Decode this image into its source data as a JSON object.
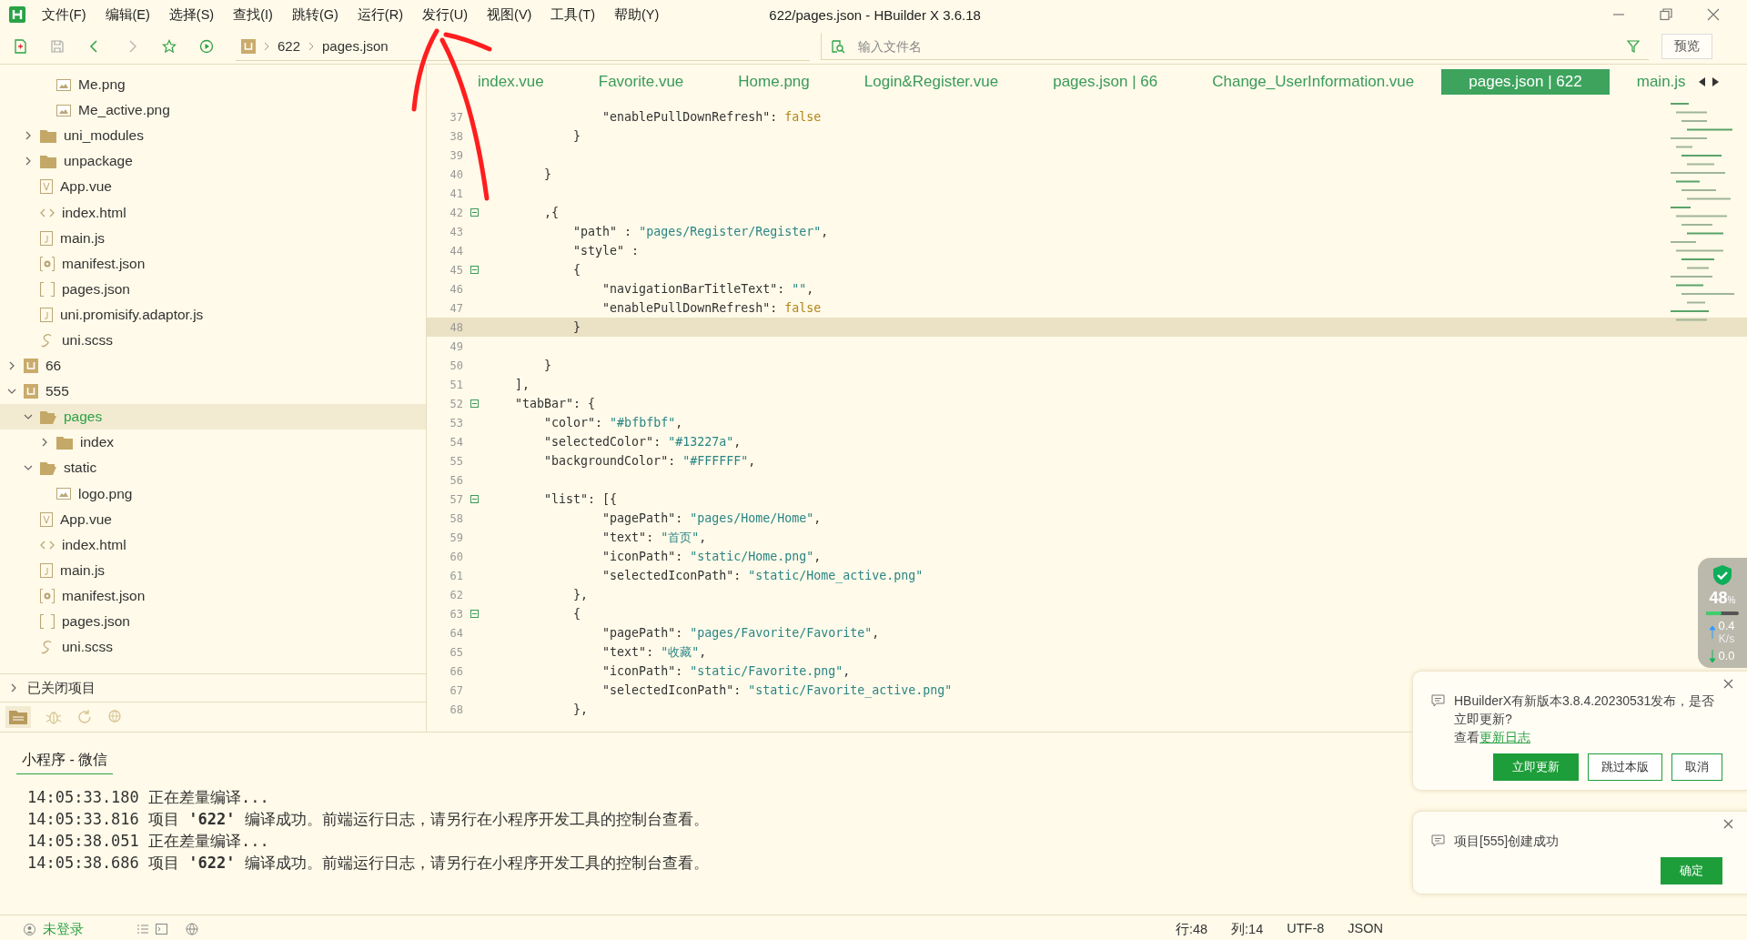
{
  "window": {
    "title": "622/pages.json - HBuilder X 3.6.18"
  },
  "menu": [
    "文件(F)",
    "编辑(E)",
    "选择(S)",
    "查找(I)",
    "跳转(G)",
    "运行(R)",
    "发行(U)",
    "视图(V)",
    "工具(T)",
    "帮助(Y)"
  ],
  "toolbar": {
    "breadcrumb": [
      "622",
      "pages.json"
    ],
    "search": {
      "placeholder": "输入文件名"
    },
    "preview_button": "预览"
  },
  "sidebar": {
    "tree": [
      {
        "children": [
          {
            "children": [
              {
                "label": "Me.png",
                "kind": "image",
                "selected": false
              },
              {
                "label": "Me_active.png",
                "kind": "image",
                "selected": false
              }
            ]
          },
          {
            "label": "uni_modules",
            "kind": "folder",
            "expanded": false,
            "selected": false
          },
          {
            "label": "unpackage",
            "kind": "folder",
            "expanded": false,
            "selected": false
          },
          {
            "label": "App.vue",
            "kind": "vue",
            "selected": false
          },
          {
            "label": "index.html",
            "kind": "html",
            "selected": false
          },
          {
            "label": "main.js",
            "kind": "js",
            "selected": false
          },
          {
            "label": "manifest.json",
            "kind": "config",
            "selected": false
          },
          {
            "label": "pages.json",
            "kind": "json",
            "selected": false
          },
          {
            "label": "uni.promisify.adaptor.js",
            "kind": "js",
            "selected": false
          },
          {
            "label": "uni.scss",
            "kind": "scss",
            "selected": false
          }
        ]
      },
      {
        "label": "66",
        "kind": "project",
        "expanded": false,
        "selected": false
      },
      {
        "label": "555",
        "kind": "project",
        "expanded": true,
        "selected": false,
        "children": [
          {
            "label": "pages",
            "kind": "folder",
            "expanded": true,
            "selected": true,
            "children": [
              {
                "label": "index",
                "kind": "folder",
                "expanded": false,
                "selected": false
              }
            ]
          },
          {
            "label": "static",
            "kind": "folder",
            "expanded": true,
            "selected": false,
            "children": [
              {
                "label": "logo.png",
                "kind": "image",
                "selected": false
              }
            ]
          },
          {
            "label": "App.vue",
            "kind": "vue",
            "selected": false
          },
          {
            "label": "index.html",
            "kind": "html",
            "selected": false
          },
          {
            "label": "main.js",
            "kind": "js",
            "selected": false
          },
          {
            "label": "manifest.json",
            "kind": "config",
            "selected": false
          },
          {
            "label": "pages.json",
            "kind": "json",
            "selected": false
          },
          {
            "label": "uni.scss",
            "kind": "scss",
            "selected": false
          }
        ]
      }
    ],
    "closed_projects": {
      "label": "已关闭项目",
      "expanded": false
    }
  },
  "tabs": [
    {
      "label": "index.vue",
      "selected": false
    },
    {
      "label": "Favorite.vue",
      "selected": false
    },
    {
      "label": "Home.png",
      "selected": false
    },
    {
      "label": "Login&Register.vue",
      "selected": false
    },
    {
      "label": "pages.json | 66",
      "selected": false
    },
    {
      "label": "Change_UserInformation.vue",
      "selected": false
    },
    {
      "label": "pages.json | 622",
      "selected": true
    },
    {
      "label": "main.js",
      "selected": false
    }
  ],
  "code": [
    {
      "n": "37",
      "tokens": [
        {
          "kind": "key",
          "s": "                \"enablePullDownRefresh\""
        },
        {
          "kind": "p",
          "s": ": "
        },
        {
          "kind": "kw",
          "s": "false"
        }
      ]
    },
    {
      "n": "38",
      "tokens": [
        {
          "kind": "p",
          "s": "            }"
        }
      ]
    },
    {
      "n": "39"
    },
    {
      "n": "40",
      "tokens": [
        {
          "kind": "p",
          "s": "        }"
        }
      ]
    },
    {
      "n": "41"
    },
    {
      "n": "42",
      "fold": true,
      "tokens": [
        {
          "kind": "p",
          "s": "        ,{"
        }
      ]
    },
    {
      "n": "43",
      "tokens": [
        {
          "kind": "key",
          "s": "            \"path\""
        },
        {
          "kind": "p",
          "s": " : "
        },
        {
          "kind": "str",
          "s": "\"pages/Register/Register\""
        },
        {
          "kind": "p",
          "s": ","
        }
      ]
    },
    {
      "n": "44",
      "tokens": [
        {
          "kind": "key",
          "s": "            \"style\""
        },
        {
          "kind": "p",
          "s": " :"
        }
      ]
    },
    {
      "n": "45",
      "fold": true,
      "tokens": [
        {
          "kind": "p",
          "s": "            {"
        }
      ]
    },
    {
      "n": "46",
      "tokens": [
        {
          "kind": "key",
          "s": "                \"navigationBarTitleText\""
        },
        {
          "kind": "p",
          "s": ": "
        },
        {
          "kind": "str",
          "s": "\"\""
        },
        {
          "kind": "p",
          "s": ","
        }
      ]
    },
    {
      "n": "47",
      "tokens": [
        {
          "kind": "key",
          "s": "                \"enablePullDownRefresh\""
        },
        {
          "kind": "p",
          "s": ": "
        },
        {
          "kind": "kw",
          "s": "false"
        }
      ]
    },
    {
      "n": "48",
      "current": true,
      "tokens": [
        {
          "kind": "p",
          "s": "            }"
        }
      ]
    },
    {
      "n": "49"
    },
    {
      "n": "50",
      "tokens": [
        {
          "kind": "p",
          "s": "        }"
        }
      ]
    },
    {
      "n": "51",
      "tokens": [
        {
          "kind": "p",
          "s": "    ],"
        }
      ]
    },
    {
      "n": "52",
      "fold": true,
      "tokens": [
        {
          "kind": "key",
          "s": "    \"tabBar\""
        },
        {
          "kind": "p",
          "s": ": {"
        }
      ]
    },
    {
      "n": "53",
      "tokens": [
        {
          "kind": "key",
          "s": "        \"color\""
        },
        {
          "kind": "p",
          "s": ": "
        },
        {
          "kind": "str",
          "s": "\"#bfbfbf\""
        },
        {
          "kind": "p",
          "s": ","
        }
      ]
    },
    {
      "n": "54",
      "tokens": [
        {
          "kind": "key",
          "s": "        \"selectedColor\""
        },
        {
          "kind": "p",
          "s": ": "
        },
        {
          "kind": "str",
          "s": "\"#13227a\""
        },
        {
          "kind": "p",
          "s": ","
        }
      ]
    },
    {
      "n": "55",
      "tokens": [
        {
          "kind": "key",
          "s": "        \"backgroundColor\""
        },
        {
          "kind": "p",
          "s": ": "
        },
        {
          "kind": "str",
          "s": "\"#FFFFFF\""
        },
        {
          "kind": "p",
          "s": ","
        }
      ]
    },
    {
      "n": "56"
    },
    {
      "n": "57",
      "fold": true,
      "tokens": [
        {
          "kind": "key",
          "s": "        \"list\""
        },
        {
          "kind": "p",
          "s": ": [{"
        }
      ]
    },
    {
      "n": "58",
      "tokens": [
        {
          "kind": "key",
          "s": "                \"pagePath\""
        },
        {
          "kind": "p",
          "s": ": "
        },
        {
          "kind": "str",
          "s": "\"pages/Home/Home\""
        },
        {
          "kind": "p",
          "s": ","
        }
      ]
    },
    {
      "n": "59",
      "tokens": [
        {
          "kind": "key",
          "s": "                \"text\""
        },
        {
          "kind": "p",
          "s": ": "
        },
        {
          "kind": "str",
          "s": "\"首页\""
        },
        {
          "kind": "p",
          "s": ","
        }
      ]
    },
    {
      "n": "60",
      "tokens": [
        {
          "kind": "key",
          "s": "                \"iconPath\""
        },
        {
          "kind": "p",
          "s": ": "
        },
        {
          "kind": "str",
          "s": "\"static/Home.png\""
        },
        {
          "kind": "p",
          "s": ","
        }
      ]
    },
    {
      "n": "61",
      "tokens": [
        {
          "kind": "key",
          "s": "                \"selectedIconPath\""
        },
        {
          "kind": "p",
          "s": ": "
        },
        {
          "kind": "str",
          "s": "\"static/Home_active.png\""
        }
      ]
    },
    {
      "n": "62",
      "tokens": [
        {
          "kind": "p",
          "s": "            },"
        }
      ]
    },
    {
      "n": "63",
      "fold": true,
      "tokens": [
        {
          "kind": "p",
          "s": "            {"
        }
      ]
    },
    {
      "n": "64",
      "tokens": [
        {
          "kind": "key",
          "s": "                \"pagePath\""
        },
        {
          "kind": "p",
          "s": ": "
        },
        {
          "kind": "str",
          "s": "\"pages/Favorite/Favorite\""
        },
        {
          "kind": "p",
          "s": ","
        }
      ]
    },
    {
      "n": "65",
      "tokens": [
        {
          "kind": "key",
          "s": "                \"text\""
        },
        {
          "kind": "p",
          "s": ": "
        },
        {
          "kind": "str",
          "s": "\"收藏\""
        },
        {
          "kind": "p",
          "s": ","
        }
      ]
    },
    {
      "n": "66",
      "tokens": [
        {
          "kind": "key",
          "s": "                \"iconPath\""
        },
        {
          "kind": "p",
          "s": ": "
        },
        {
          "kind": "str",
          "s": "\"static/Favorite.png\""
        },
        {
          "kind": "p",
          "s": ","
        }
      ]
    },
    {
      "n": "67",
      "tokens": [
        {
          "kind": "key",
          "s": "                \"selectedIconPath\""
        },
        {
          "kind": "p",
          "s": ": "
        },
        {
          "kind": "str",
          "s": "\"static/Favorite_active.png\""
        }
      ]
    },
    {
      "n": "68",
      "tokens": [
        {
          "kind": "p",
          "s": "            },"
        }
      ]
    }
  ],
  "console": {
    "tab": "小程序 - 微信",
    "lines": [
      {
        "time": "14:05:33.180",
        "text": "正在差量编译..."
      },
      {
        "time": "14:05:33.816",
        "text": "项目 **'622'** 编译成功。前端运行日志，请另行在小程序开发工具的控制台查看。"
      },
      {
        "time": "14:05:38.051",
        "text": "正在差量编译..."
      },
      {
        "time": "14:05:38.686",
        "text": "项目 **'622'** 编译成功。前端运行日志，请另行在小程序开发工具的控制台查看。"
      }
    ]
  },
  "monitor": {
    "percent": "48",
    "unit": "%",
    "level": 0.48,
    "upload": "0.4",
    "upload_unit": "K/s",
    "download": "0.0"
  },
  "notifications": [
    {
      "message": "HBuilderX有新版本3.8.4.20230531发布，是否立即更新?",
      "prefix": "查看",
      "link": "更新日志",
      "buttons": [
        {
          "label": "立即更新",
          "primary": true
        },
        {
          "label": "跳过本版",
          "primary": false
        },
        {
          "label": "取消",
          "primary": false
        }
      ]
    },
    {
      "message": "项目[555]创建成功",
      "buttons": [
        {
          "label": "确定",
          "primary": true
        }
      ]
    }
  ],
  "status_bar": {
    "user": "未登录",
    "line": "行:48",
    "column": "列:14",
    "encoding": "UTF-8",
    "language": "JSON"
  }
}
